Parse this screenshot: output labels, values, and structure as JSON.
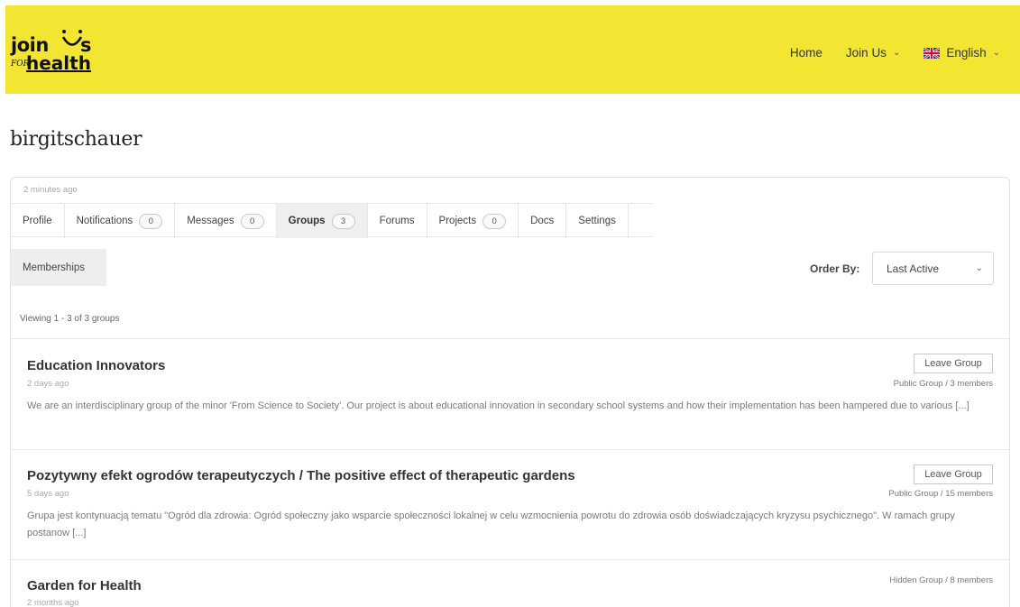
{
  "brand": {
    "logo_top": "join",
    "logo_top_end": "s",
    "logo_for": "FOR",
    "logo_bottom": "health"
  },
  "nav": {
    "home": "Home",
    "join_us": "Join Us",
    "language": "English"
  },
  "page_title": "birgitschauer",
  "activity": "2 minutes ago",
  "tabs": [
    {
      "label": "Profile",
      "count": null
    },
    {
      "label": "Notifications",
      "count": "0"
    },
    {
      "label": "Messages",
      "count": "0"
    },
    {
      "label": "Groups",
      "count": "3"
    },
    {
      "label": "Forums",
      "count": null
    },
    {
      "label": "Projects",
      "count": "0"
    },
    {
      "label": "Docs",
      "count": null
    },
    {
      "label": "Settings",
      "count": null
    }
  ],
  "subnav": {
    "memberships": "Memberships"
  },
  "order": {
    "label": "Order By:",
    "selected": "Last Active"
  },
  "viewing": "Viewing 1 - 3 of 3 groups",
  "groups": [
    {
      "name": "Education Innovators",
      "time": "2 days ago",
      "meta": "Public Group / 3 members",
      "button": "Leave Group",
      "description": "We are an interdisciplinary group of the minor 'From Science to Society'. Our project is about educational innovation in secondary school systems and how their implementation has been hampered due to various [...]"
    },
    {
      "name": "Pozytywny efekt ogrodów terapeutyczych / The positive effect of therapeutic gardens",
      "time": "5 days ago",
      "meta": "Public Group / 15 members",
      "button": "Leave Group",
      "description": "Grupa jest kontynuacją tematu \"Ogród dla zdrowia: Ogród społeczny jako wsparcie społeczności lokalnej w celu wzmocnienia powrotu do zdrowia osób doświadczających kryzysu psychicznego\". W ramach grupy postanow [...]"
    },
    {
      "name": "Garden for Health",
      "time": "2 months ago",
      "meta": "Hidden Group / 8 members"
    }
  ],
  "colors": {
    "header_bg": "#f2e633",
    "active_tab_bg": "#efefef"
  }
}
